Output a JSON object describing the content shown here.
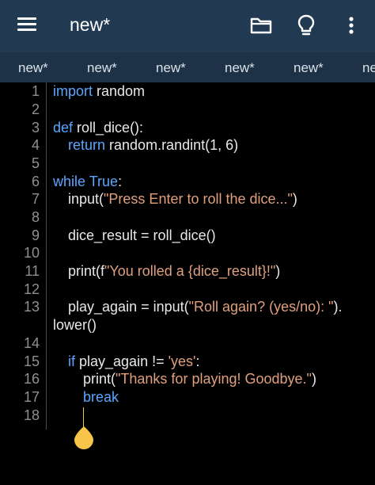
{
  "appbar": {
    "title": "new*",
    "icons": [
      "menu-icon",
      "folder-icon",
      "lightbulb-icon",
      "more-vert-icon"
    ]
  },
  "tabs": [
    "new*",
    "new*",
    "new*",
    "new*",
    "new*",
    "ne"
  ],
  "editor": {
    "line_numbers": [
      "1",
      "2",
      "3",
      "4",
      "5",
      "6",
      "7",
      "8",
      "9",
      "10",
      "11",
      "12",
      "13",
      "14",
      "15",
      "16",
      "17",
      "18"
    ],
    "lines": {
      "l1_kw": "import",
      "l1_rest": " random",
      "l3_kw": "def",
      "l3_rest": " roll_dice():",
      "l4_kw": "return",
      "l4_rest": " random.randint(1, 6)",
      "l6_kw": "while",
      "l6_kw2": "True",
      "l6_rest": ":",
      "l7_a": "input(",
      "l7_str": "\"Press Enter to roll the dice...\"",
      "l7_b": ")",
      "l9": "dice_result = roll_dice()",
      "l11_a": "print(f",
      "l11_str": "\"You rolled a {dice_result}!\"",
      "l11_b": ")",
      "l13_a": "play_again = input(",
      "l13_str": "\"Roll again? (yes/no): \"",
      "l13_b": ").",
      "l13_wrap": "lower()",
      "l15_kw": "if",
      "l15_a": " play_again != ",
      "l15_str": "'yes'",
      "l15_b": ":",
      "l16_a": "print(",
      "l16_str": "\"Thanks for playing! Goodbye.\"",
      "l16_b": ")",
      "l17_kw": "break"
    }
  },
  "colors": {
    "appbar_bg": "#213a52",
    "tabbar_bg": "#1d3247",
    "keyword": "#5aa6ff",
    "string": "#e0a07e",
    "cursor_handle": "#f6c54a"
  }
}
